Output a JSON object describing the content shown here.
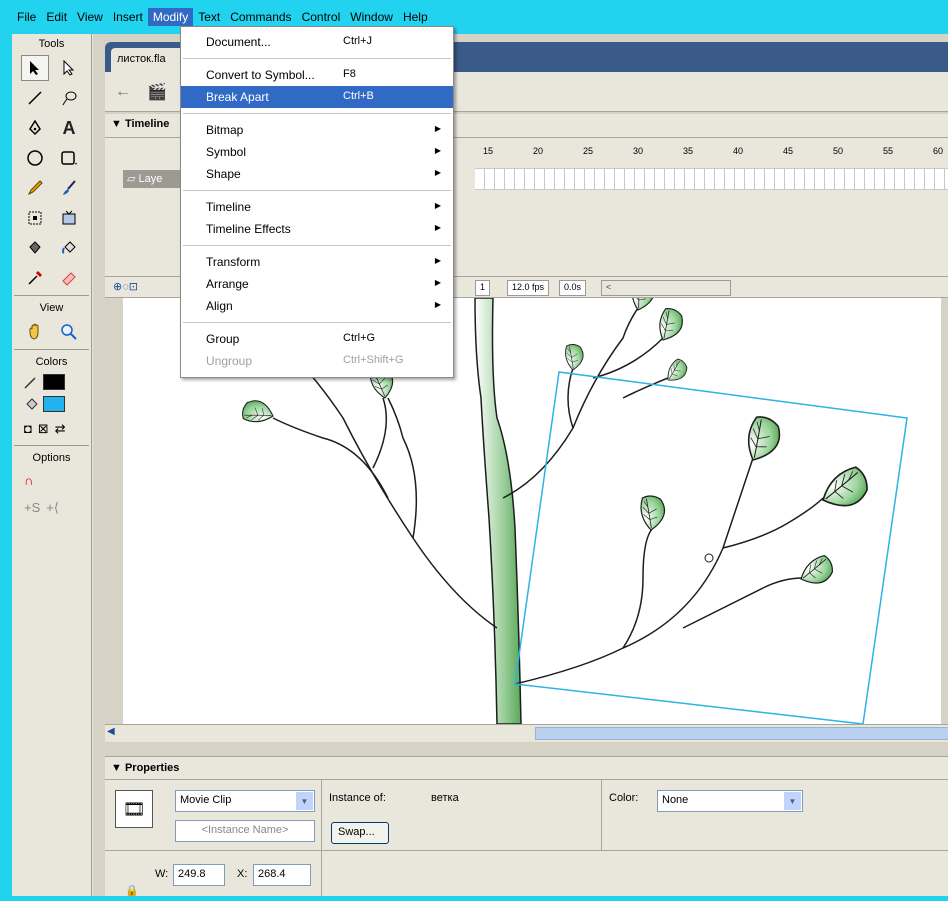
{
  "menubar": {
    "items": [
      "File",
      "Edit",
      "View",
      "Insert",
      "Modify",
      "Text",
      "Commands",
      "Control",
      "Window",
      "Help"
    ],
    "active": "Modify"
  },
  "tools_panel": {
    "tools_title": "Tools",
    "view_title": "View",
    "colors_title": "Colors",
    "options_title": "Options",
    "tools": [
      "arrow-icon",
      "subselect-icon",
      "line-icon",
      "lasso-icon",
      "pen-icon",
      "text-icon",
      "oval-icon",
      "rectangle-icon",
      "pencil-icon",
      "brush-icon",
      "free-transform-icon",
      "fill-transform-icon",
      "ink-bottle-icon",
      "paint-bucket-icon",
      "eyedropper-icon",
      "eraser-icon"
    ],
    "stroke_color": "#000000",
    "fill_color": "#22b2ee"
  },
  "document": {
    "tab_label": "листок.fla"
  },
  "timeline": {
    "title": "Timeline",
    "ruler_numbers": [
      "15",
      "20",
      "25",
      "30",
      "35",
      "40",
      "45",
      "50",
      "55",
      "60"
    ],
    "layer_name": "Laye",
    "current_frame": "1",
    "frame_rate": "12.0 fps",
    "elapsed": "0.0s"
  },
  "modify_menu": {
    "items": [
      {
        "label": "Document...",
        "shortcut": "Ctrl+J"
      },
      {
        "sep": true
      },
      {
        "label": "Convert to Symbol...",
        "shortcut": "F8"
      },
      {
        "label": "Break Apart",
        "shortcut": "Ctrl+B",
        "highlighted": true
      },
      {
        "sep": true
      },
      {
        "label": "Bitmap",
        "submenu": true
      },
      {
        "label": "Symbol",
        "submenu": true
      },
      {
        "label": "Shape",
        "submenu": true
      },
      {
        "sep": true
      },
      {
        "label": "Timeline",
        "submenu": true
      },
      {
        "label": "Timeline Effects",
        "submenu": true
      },
      {
        "sep": true
      },
      {
        "label": "Transform",
        "submenu": true
      },
      {
        "label": "Arrange",
        "submenu": true
      },
      {
        "label": "Align",
        "submenu": true
      },
      {
        "sep": true
      },
      {
        "label": "Group",
        "shortcut": "Ctrl+G"
      },
      {
        "label": "Ungroup",
        "shortcut": "Ctrl+Shift+G",
        "disabled": true
      }
    ]
  },
  "properties": {
    "title": "Properties",
    "symbol_type": "Movie Clip",
    "instance_name_placeholder": "<Instance Name>",
    "instance_of_label": "Instance of:",
    "instance_of_value": "ветка",
    "swap_label": "Swap...",
    "color_label": "Color:",
    "color_value": "None",
    "w_label": "W:",
    "w_value": "249.8",
    "x_label": "X:",
    "x_value": "268.4"
  },
  "colors": {
    "accent": "#22d3f0",
    "menu_highlight": "#316ac5",
    "leaf_green": "#5aa85a",
    "selection_box": "#2bb3e6"
  }
}
